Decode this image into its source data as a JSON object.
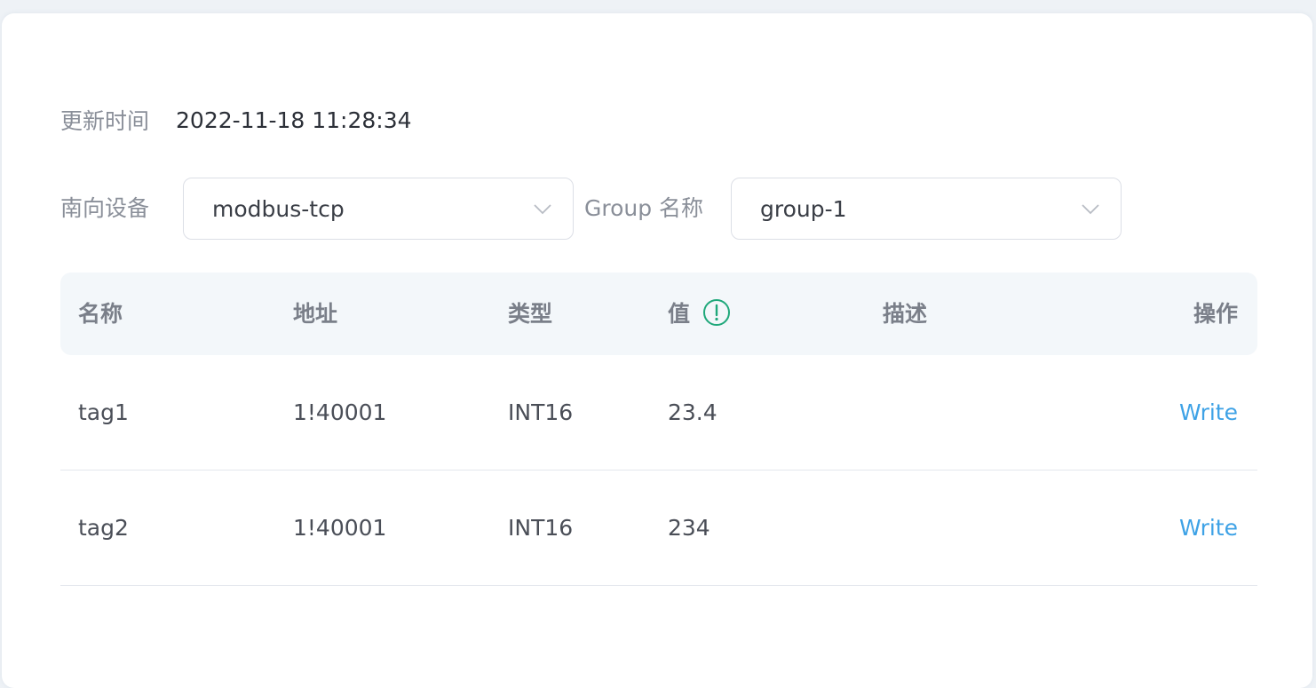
{
  "update": {
    "label": "更新时间",
    "value": "2022-11-18 11:28:34"
  },
  "filters": {
    "device_label": "南向设备",
    "device_value": "modbus-tcp",
    "group_label": "Group 名称",
    "group_value": "group-1"
  },
  "table": {
    "headers": {
      "name": "名称",
      "address": "地址",
      "type": "类型",
      "value": "值",
      "description": "描述",
      "action": "操作"
    },
    "rows": [
      {
        "name": "tag1",
        "address": "1!40001",
        "type": "INT16",
        "value": "23.4",
        "description": "",
        "action": "Write"
      },
      {
        "name": "tag2",
        "address": "1!40001",
        "type": "INT16",
        "value": "234",
        "description": "",
        "action": "Write"
      }
    ]
  },
  "colors": {
    "link": "#3ea2e6",
    "info_icon": "#1fa87a",
    "header_bg": "#f3f7fa"
  },
  "icons": {
    "select_arrow": "chevron-down-icon",
    "value_info": "info-circle-icon"
  }
}
